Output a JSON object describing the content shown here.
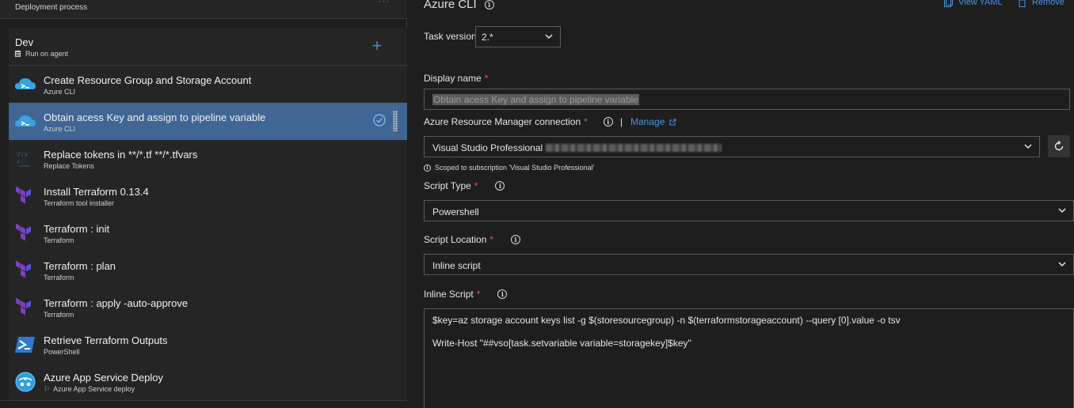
{
  "process": {
    "title": "Deployment process",
    "more": "···"
  },
  "stage": {
    "name": "Dev",
    "subtitle": "Run on agent",
    "add_icon": "plus-icon"
  },
  "tasks": [
    {
      "title": "Create Resource Group and Storage Account",
      "subtitle": "Azure CLI",
      "icon": "azure-cli-icon"
    },
    {
      "title": "Obtain acess Key and assign to pipeline variable",
      "subtitle": "Azure CLI",
      "icon": "azure-cli-icon",
      "selected": true
    },
    {
      "title": "Replace tokens in **/*.tf **/*.tfvars",
      "subtitle": "Replace Tokens",
      "icon": "replace-tokens-icon"
    },
    {
      "title": "Install Terraform 0.13.4",
      "subtitle": "Terraform tool installer",
      "icon": "terraform-icon"
    },
    {
      "title": "Terraform : init",
      "subtitle": "Terraform",
      "icon": "terraform-icon"
    },
    {
      "title": "Terraform : plan",
      "subtitle": "Terraform",
      "icon": "terraform-icon"
    },
    {
      "title": "Terraform : apply -auto-approve",
      "subtitle": "Terraform",
      "icon": "terraform-icon"
    },
    {
      "title": "Retrieve Terraform Outputs",
      "subtitle": "PowerShell",
      "icon": "powershell-icon"
    },
    {
      "title": "Azure App Service Deploy",
      "subtitle": "Azure App Service deploy",
      "icon": "app-service-icon"
    }
  ],
  "detail": {
    "title": "Azure CLI",
    "view_yaml": "View YAML",
    "remove": "Remove",
    "task_version_label": "Task version",
    "task_version_value": "2.*",
    "display_name_label": "Display name",
    "display_name_value": "Obtain acess Key and assign to pipeline variable",
    "arm_label": "Azure Resource Manager connection",
    "manage_sep": "|",
    "manage_label": "Manage",
    "arm_value": "Visual Studio Professional",
    "scope_note": "Scoped to subscription 'Visual Studio Professional'",
    "script_type_label": "Script Type",
    "script_type_value": "Powershell",
    "script_location_label": "Script Location",
    "script_location_value": "Inline script",
    "inline_script_label": "Inline Script",
    "inline_script_lines": [
      "$key=az storage account keys list -g $(storesourcegroup) -n $(terraformstorageaccount) --query [0].value -o tsv",
      "Write-Host \"##vso[task.setvariable variable=storagekey]$key\""
    ],
    "required_mark": "*"
  },
  "colors": {
    "accent": "#3b8fdb",
    "selected_row": "#3f6694",
    "required": "#e05a5a",
    "terraform": "#7b42bc"
  }
}
